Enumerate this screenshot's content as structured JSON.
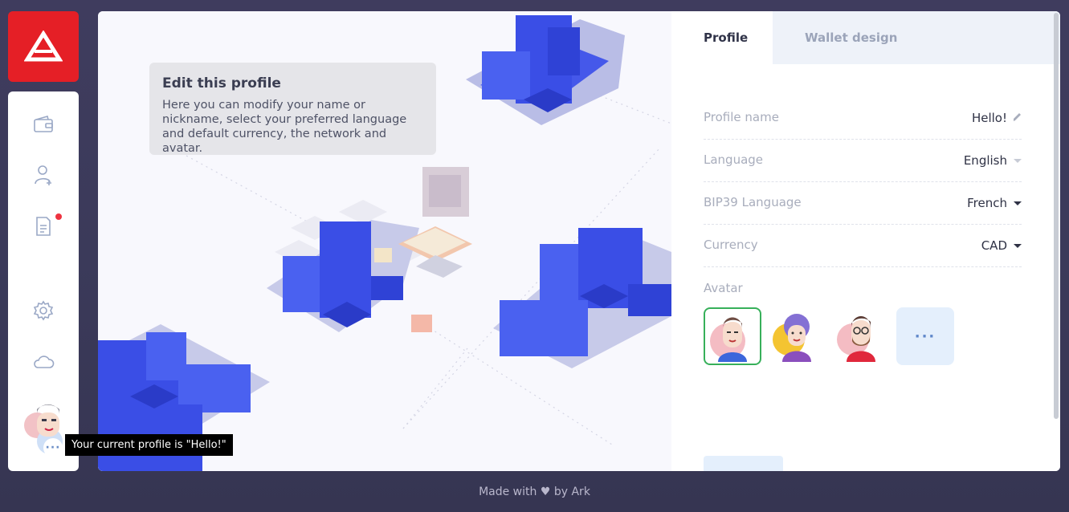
{
  "colors": {
    "brand": "#e51f26",
    "accent": "#37b05a",
    "notification": "#ee3340"
  },
  "sidebar": {
    "logo_icon": "ark-logo-icon",
    "items": [
      {
        "name": "wallet-icon"
      },
      {
        "name": "add-contact-icon"
      },
      {
        "name": "announcements-icon",
        "has_notification": true
      },
      {
        "name": "settings-icon"
      },
      {
        "name": "network-cloud-icon"
      }
    ],
    "profile_more": "···"
  },
  "tooltip": {
    "text": "Your current profile is \"Hello!\""
  },
  "info": {
    "title": "Edit this profile",
    "text": "Here you can modify your name or nickname, select your preferred language and default currency, the network and avatar."
  },
  "tabs": [
    {
      "label": "Profile",
      "active": true
    },
    {
      "label": "Wallet design",
      "active": false
    }
  ],
  "form": {
    "profile_name": {
      "label": "Profile name",
      "value": "Hello!"
    },
    "language": {
      "label": "Language",
      "value": "English"
    },
    "bip39_language": {
      "label": "BIP39 Language",
      "value": "French"
    },
    "currency": {
      "label": "Currency",
      "value": "CAD"
    },
    "avatar": {
      "label": "Avatar",
      "more": "···"
    }
  },
  "footer": {
    "prefix": "Made with",
    "heart": "♥",
    "suffix": "by Ark"
  }
}
